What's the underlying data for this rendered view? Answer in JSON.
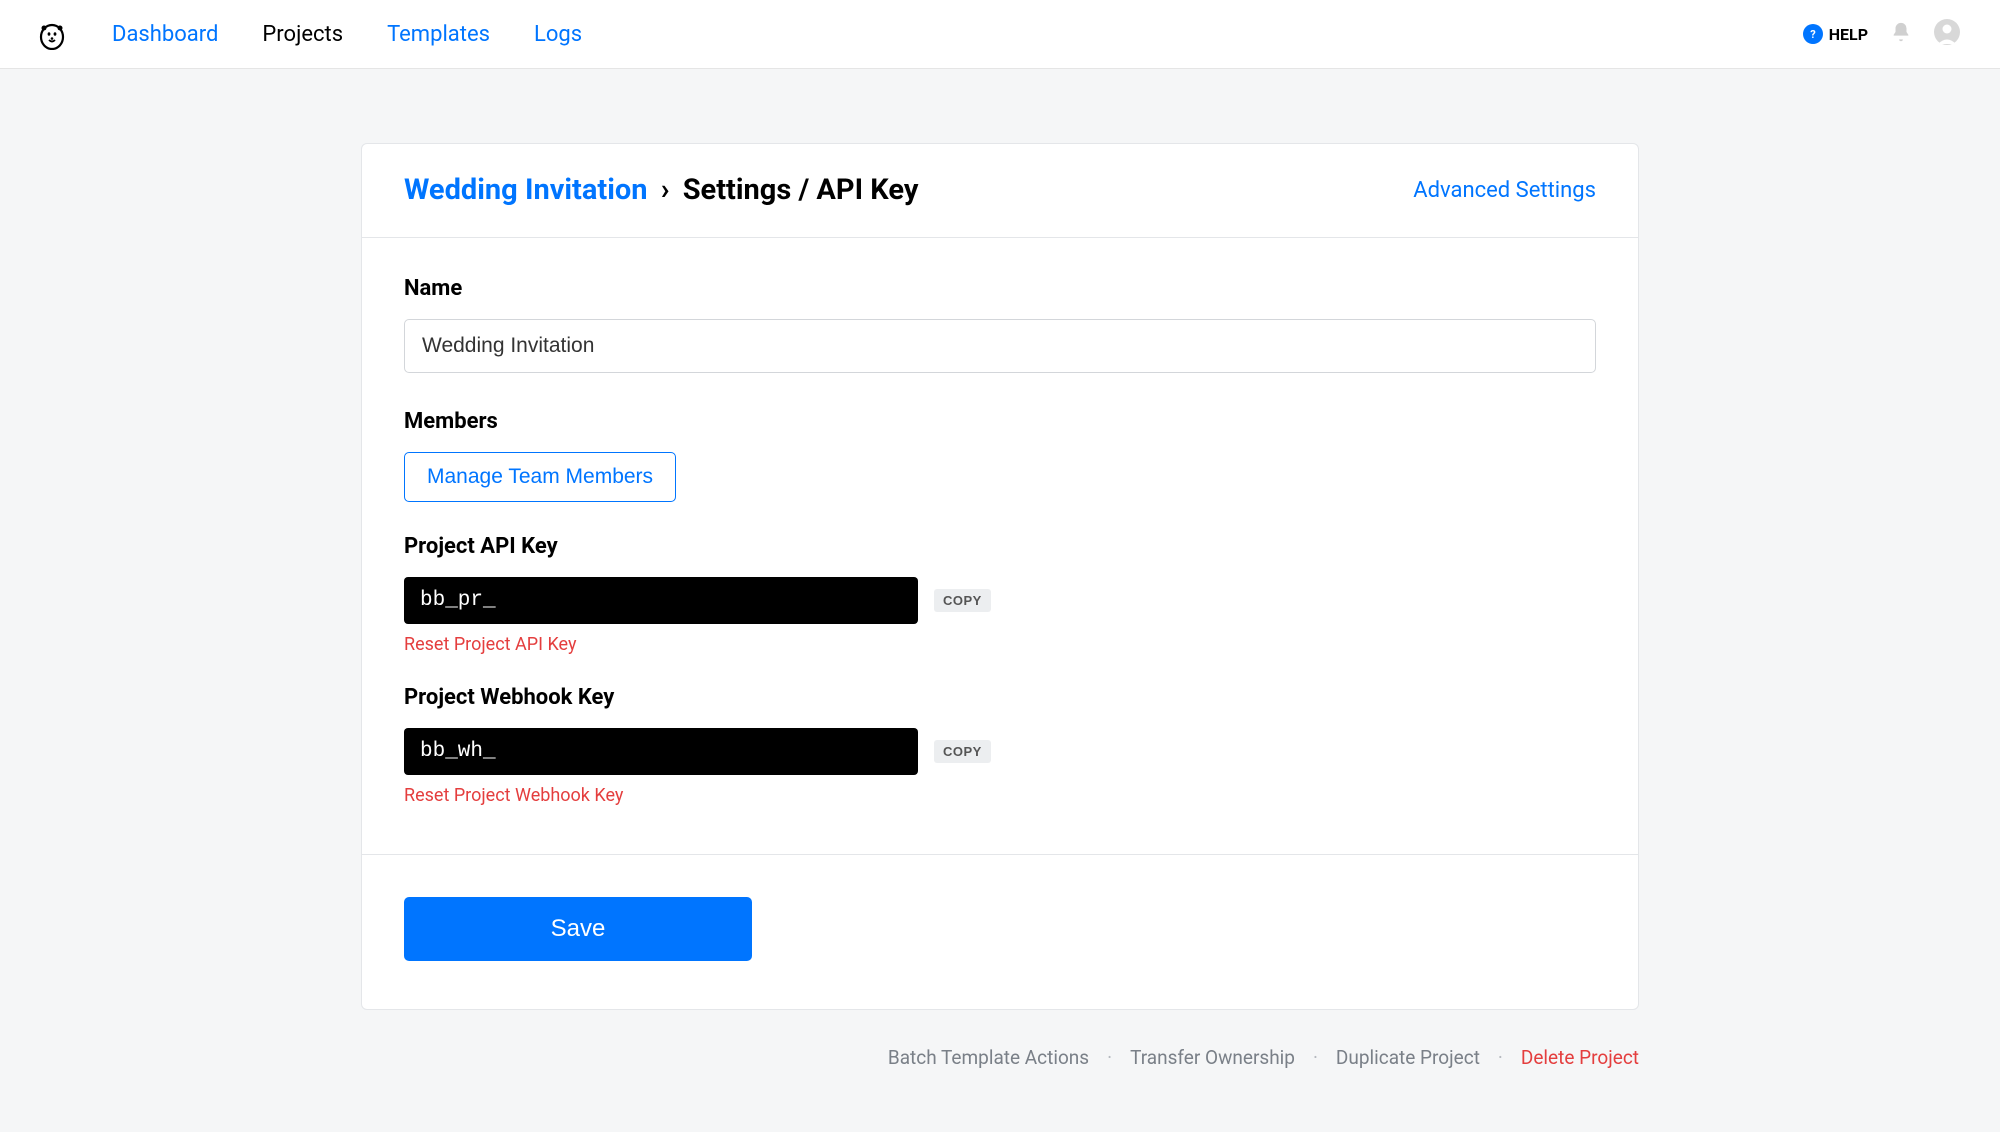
{
  "nav": {
    "dashboard": "Dashboard",
    "projects": "Projects",
    "templates": "Templates",
    "logs": "Logs"
  },
  "header": {
    "help": "HELP"
  },
  "breadcrumb": {
    "project": "Wedding Invitation",
    "sep": "›",
    "current": "Settings / API Key"
  },
  "advanced_link": "Advanced Settings",
  "form": {
    "name_label": "Name",
    "name_value": "Wedding Invitation",
    "members_label": "Members",
    "manage_members": "Manage Team Members",
    "api_key_label": "Project API Key",
    "api_key_value": "bb_pr_",
    "copy": "COPY",
    "reset_api": "Reset Project API Key",
    "webhook_label": "Project Webhook Key",
    "webhook_value": "bb_wh_",
    "reset_webhook": "Reset Project Webhook Key"
  },
  "save": "Save",
  "footer": {
    "batch": "Batch Template Actions",
    "transfer": "Transfer Ownership",
    "duplicate": "Duplicate Project",
    "delete": "Delete Project",
    "sep": "·"
  }
}
